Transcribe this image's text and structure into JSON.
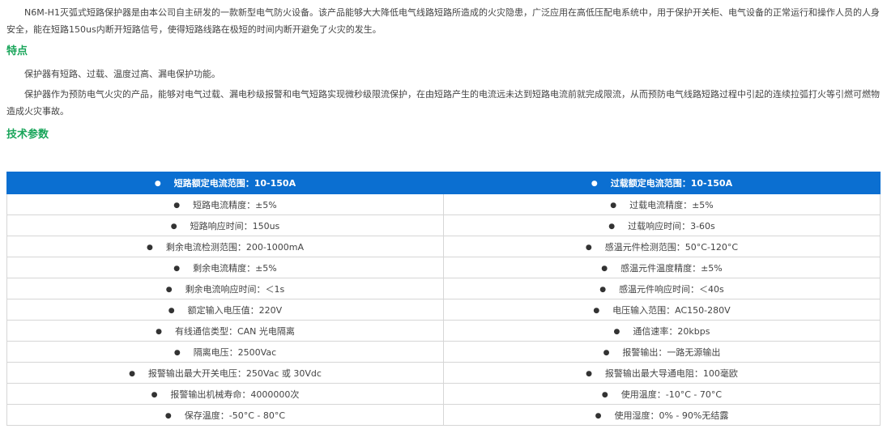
{
  "intro": "N6M-H1灭弧式短路保护器是由本公司自主研发的一款新型电气防火设备。该产品能够大大降低电气线路短路所造成的火灾隐患，广泛应用在高低压配电系统中，用于保护开关柜、电气设备的正常运行和操作人员的人身安全，能在短路150us内断开短路信号，使得短路线路在极短的时间内断开避免了火灾的发生。",
  "features": {
    "title": "特点",
    "items": [
      "保护器有短路、过载、温度过高、漏电保护功能。",
      "保护器作为预防电气火灾的产品，能够对电气过载、漏电秒级报警和电气短路实现微秒级限流保护，在由短路产生的电流远未达到短路电流前就完成限流，从而预防电气线路短路过程中引起的连续拉弧打火等引燃可燃物造成火灾事故。"
    ]
  },
  "specs": {
    "title": "技术参数",
    "bullet": "●",
    "header": [
      "短路额定电流范围：10-150A",
      "过载额定电流范围：10-150A"
    ],
    "rows": [
      [
        "短路电流精度：±5%",
        "过载电流精度：±5%"
      ],
      [
        "短路响应时间：150us",
        "过载响应时间：3-60s"
      ],
      [
        "剩余电流检测范围：200-1000mA",
        "感温元件检测范围：50°C-120°C"
      ],
      [
        "剩余电流精度：±5%",
        "感温元件温度精度：±5%"
      ],
      [
        "剩余电流响应时间：＜1s",
        "感温元件响应时间：＜40s"
      ],
      [
        "额定输入电压值：220V",
        "电压输入范围：AC150-280V"
      ],
      [
        "有线通信类型：CAN 光电隔离",
        "通信速率：20kbps"
      ],
      [
        "隔离电压：2500Vac",
        "报警输出：一路无源输出"
      ],
      [
        "报警输出最大开关电压：250Vac 或 30Vdc",
        "报警输出最大导通电阻：100毫欧"
      ],
      [
        "报警输出机械寿命：4000000次",
        "使用温度：-10°C - 70°C"
      ],
      [
        "保存温度：-50°C - 80°C",
        "使用湿度：0% - 90%无结露"
      ]
    ]
  },
  "colors": {
    "accent_green": "#19a55a",
    "header_blue": "#0b6fd1"
  }
}
